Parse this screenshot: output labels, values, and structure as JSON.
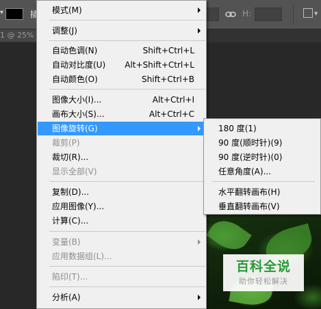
{
  "options_bar": {
    "label": "插",
    "height_label": "H:"
  },
  "document_tab": {
    "title": "1 @ 25% ("
  },
  "main_menu": {
    "items": [
      {
        "label": "模式(M)",
        "shortcut": "",
        "submenu": true,
        "enabled": true
      },
      {
        "label": "调整(J)",
        "shortcut": "",
        "submenu": true,
        "enabled": true
      },
      {
        "label": "自动色调(N)",
        "shortcut": "Shift+Ctrl+L",
        "submenu": false,
        "enabled": true
      },
      {
        "label": "自动对比度(U)",
        "shortcut": "Alt+Shift+Ctrl+L",
        "submenu": false,
        "enabled": true
      },
      {
        "label": "自动颜色(O)",
        "shortcut": "Shift+Ctrl+B",
        "submenu": false,
        "enabled": true
      },
      {
        "label": "图像大小(I)...",
        "shortcut": "Alt+Ctrl+I",
        "submenu": false,
        "enabled": true
      },
      {
        "label": "画布大小(S)...",
        "shortcut": "Alt+Ctrl+C",
        "submenu": false,
        "enabled": true
      },
      {
        "label": "图像旋转(G)",
        "shortcut": "",
        "submenu": true,
        "enabled": true,
        "highlighted": true
      },
      {
        "label": "裁剪(P)",
        "shortcut": "",
        "submenu": false,
        "enabled": false
      },
      {
        "label": "裁切(R)...",
        "shortcut": "",
        "submenu": false,
        "enabled": true
      },
      {
        "label": "显示全部(V)",
        "shortcut": "",
        "submenu": false,
        "enabled": false
      },
      {
        "label": "复制(D)...",
        "shortcut": "",
        "submenu": false,
        "enabled": true
      },
      {
        "label": "应用图像(Y)...",
        "shortcut": "",
        "submenu": false,
        "enabled": true
      },
      {
        "label": "计算(C)...",
        "shortcut": "",
        "submenu": false,
        "enabled": true
      },
      {
        "label": "变量(B)",
        "shortcut": "",
        "submenu": true,
        "enabled": false
      },
      {
        "label": "应用数据组(L)...",
        "shortcut": "",
        "submenu": false,
        "enabled": false
      },
      {
        "label": "陷印(T)...",
        "shortcut": "",
        "submenu": false,
        "enabled": false
      },
      {
        "label": "分析(A)",
        "shortcut": "",
        "submenu": true,
        "enabled": true
      }
    ]
  },
  "rotate_submenu": {
    "items": [
      {
        "label": "180 度(1)"
      },
      {
        "label": "90 度(顺时针)(9)"
      },
      {
        "label": "90 度(逆时针)(0)"
      },
      {
        "label": "任意角度(A)..."
      },
      {
        "label": "水平翻转画布(H)"
      },
      {
        "label": "垂直翻转画布(V)"
      }
    ]
  },
  "watermark": {
    "title": "百科全说",
    "subtitle": "助你轻松解决"
  },
  "colors": {
    "menu_bg": "#f0f0f0",
    "highlight": "#3399ff",
    "disabled_text": "#8d8d8d",
    "options_bar": "#535353",
    "workspace": "#282828",
    "watermark_green": "#2a9a36"
  }
}
